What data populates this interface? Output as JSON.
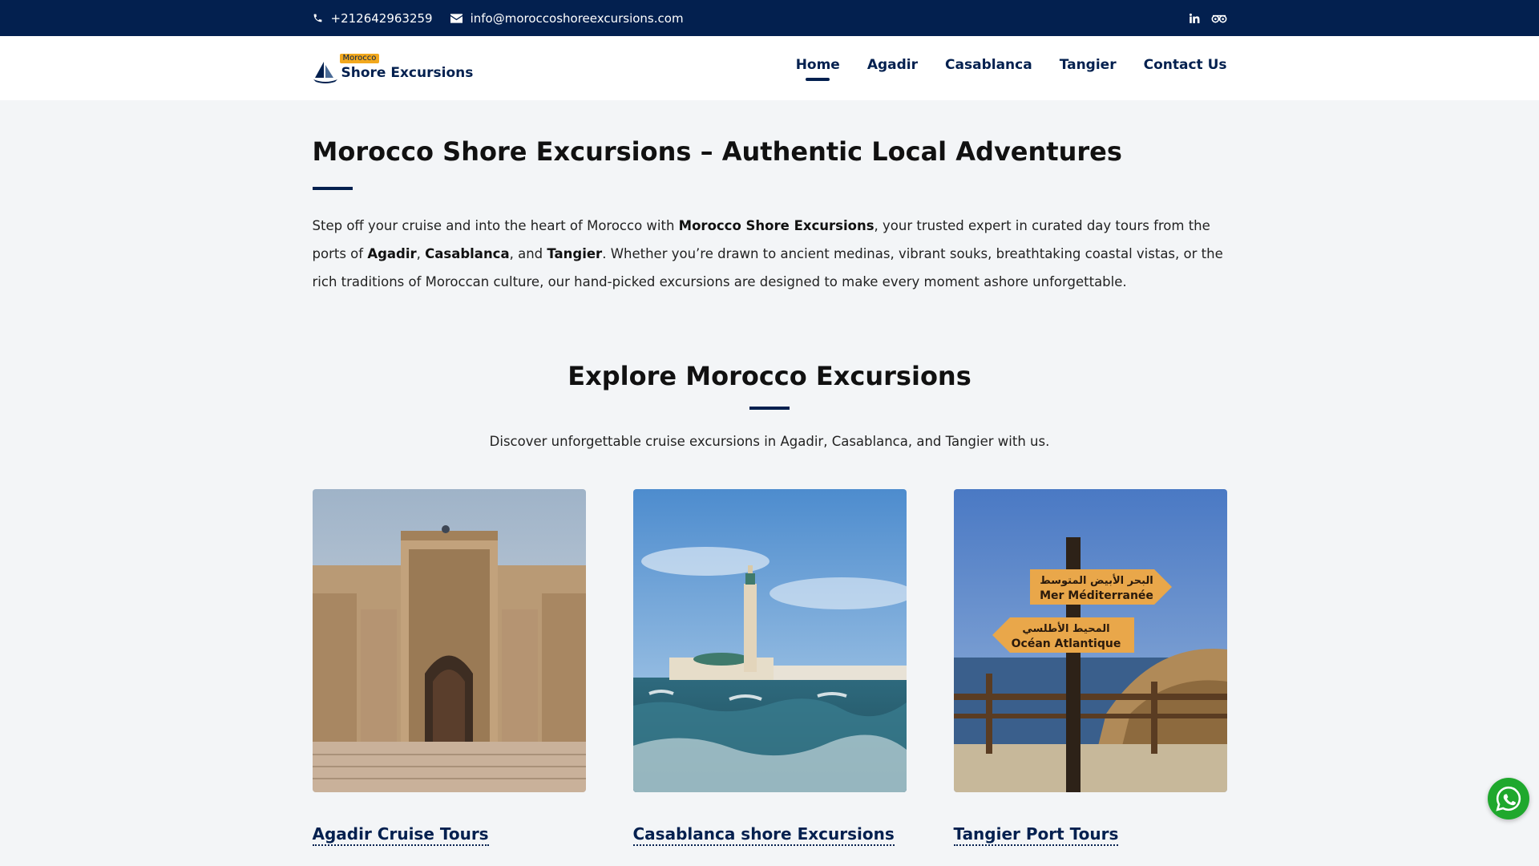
{
  "topbar": {
    "phone": "+212642963259",
    "email": "info@moroccoshoreexcursions.com",
    "social": [
      {
        "icon": "linkedin-icon",
        "label": "in"
      },
      {
        "icon": "tripadvisor-icon"
      }
    ]
  },
  "header": {
    "logo_badge": "Morocco",
    "logo_name": "Shore Excursions",
    "nav": [
      "Home",
      "Agadir",
      "Casablanca",
      "Tangier",
      "Contact Us"
    ],
    "active_nav": "Home"
  },
  "hero": {
    "title": "Morocco Shore Excursions – Authentic Local Adventures",
    "intro": {
      "t1": "Step off your cruise and into the heart of Morocco with ",
      "b1": "Morocco Shore Excursions",
      "t2": ", your trusted expert in curated day tours from the ports of ",
      "b2": "Agadir",
      "t3": ", ",
      "b3": "Casablanca",
      "t4": ", and ",
      "b4": "Tangier",
      "t5": ". Whether you’re drawn to ancient medinas, vibrant souks, breathtaking coastal vistas, or the rich traditions of Moroccan culture, our hand-picked excursions are designed to make every moment ashore unforgettable."
    }
  },
  "explore": {
    "title": "Explore Morocco Excursions",
    "subtitle": "Discover unforgettable cruise excursions in Agadir, Casablanca, and Tangier with us.",
    "cards": [
      {
        "title": "Agadir Cruise Tours"
      },
      {
        "title": "Casablanca shore Excursions"
      },
      {
        "title": "Tangier Port Tours"
      }
    ],
    "sign_text": {
      "ar1": "البحر الأبيض المتوسط",
      "fr1": "Mer Méditerranée",
      "ar2": "المحيط الأطلسي",
      "fr2": "Océan Atlantique"
    }
  },
  "colors": {
    "navy": "#03204f",
    "accent": "#f2a81d",
    "whatsapp": "#1fa82d"
  }
}
